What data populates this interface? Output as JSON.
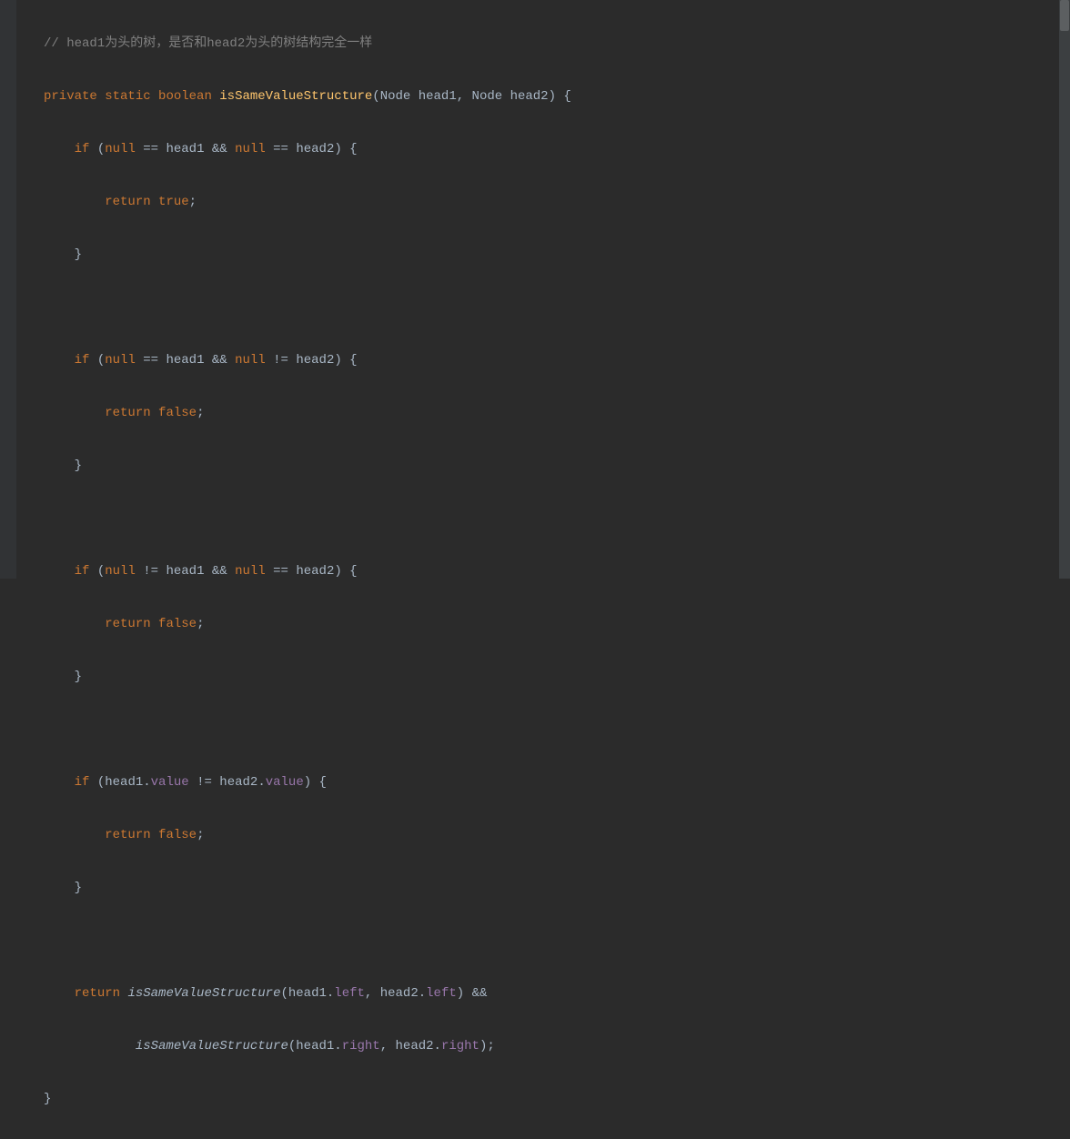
{
  "code": {
    "comment1": "// head1为头的树，是否和head2为头的树结构完全一样",
    "kw_private": "private",
    "kw_static": "static",
    "kw_boolean": "boolean",
    "method_name": "isSameValueStructure",
    "type_node": "Node",
    "param_head1": "head1",
    "param_head2": "head2",
    "kw_if": "if",
    "kw_null": "null",
    "op_eq": "==",
    "op_neq": "!=",
    "op_and": "&&",
    "kw_return": "return",
    "kw_true": "true",
    "kw_false": "false",
    "field_value": "value",
    "field_left": "left",
    "field_right": "right",
    "call_isSameValueStructure": "isSameValueStructure"
  }
}
